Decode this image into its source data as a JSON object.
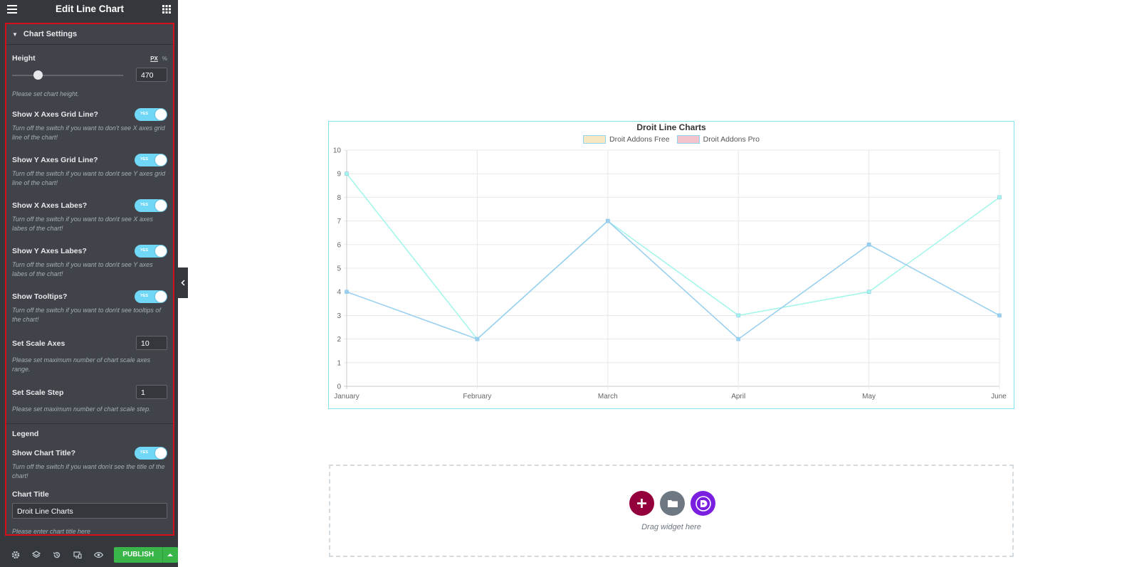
{
  "header": {
    "title": "Edit Line Chart",
    "menu_icon": "hamburger-icon",
    "grid_icon": "apps-grid-icon"
  },
  "section": {
    "title": "Chart Settings"
  },
  "controls": {
    "height": {
      "label": "Height",
      "unit_px": "PX",
      "unit_pct": "%",
      "value": "470",
      "slider_level": 0.23,
      "desc": "Please set chart height."
    },
    "x_grid": {
      "label": "Show X Axes Grid Line?",
      "toggle": "YES",
      "desc": "Turn off the switch if you want to don't see X axes grid line of the chart!"
    },
    "y_grid": {
      "label": "Show Y Axes Grid Line?",
      "toggle": "YES",
      "desc": "Turn off the switch if you want to don\\t see Y axes grid line of the chart!"
    },
    "x_labels": {
      "label": "Show X Axes Labes?",
      "toggle": "YES",
      "desc": "Turn off the switch if you want to don\\t see X axes labes of the chart!"
    },
    "y_labels": {
      "label": "Show Y Axes Labes?",
      "toggle": "YES",
      "desc": "Turn off the switch if you want to don\\t see Y axes labes of the chart!"
    },
    "tooltips": {
      "label": "Show Tooltips?",
      "toggle": "YES",
      "desc": "Turn off the switch if you want to don\\t see tooltips of the chart!"
    },
    "scale_axes": {
      "label": "Set Scale Axes",
      "value": "10",
      "desc": "Please set maximum number of chart scale axes range."
    },
    "scale_step": {
      "label": "Set Scale Step",
      "value": "1",
      "desc": "Please set maximum number of chart scale step."
    },
    "legend_heading": "Legend",
    "show_title": {
      "label": "Show Chart Title?",
      "toggle": "YES",
      "desc": "Turn off the switch if you want don\\t see the title of the chart!"
    },
    "chart_title": {
      "label": "Chart Title",
      "value": "Droit Line Charts",
      "desc": "Please enter chart title here"
    }
  },
  "footer": {
    "publish_label": "PUBLISH"
  },
  "dropzone": {
    "text": "Drag widget here",
    "add_icon": "plus-icon",
    "template_icon": "folder-icon",
    "droit_icon": "droit-logo-icon"
  },
  "colors": {
    "accent_toggle": "#71d7f7",
    "publish": "#39b54a",
    "highlight_border": "#d40f1a",
    "series_free": "#a5f6ea",
    "series_pro": "#9ad0ef"
  },
  "chart_data": {
    "type": "line",
    "title": "Droit Line Charts",
    "categories": [
      "January",
      "February",
      "March",
      "April",
      "May",
      "June"
    ],
    "series": [
      {
        "name": "Droit Addons Free",
        "values": [
          9,
          2,
          7,
          3,
          4,
          8
        ],
        "color": "#a5f6ea",
        "legend_fill": "#f7e8c4"
      },
      {
        "name": "Droit Addons Pro",
        "values": [
          4,
          2,
          7,
          2,
          6,
          3
        ],
        "color": "#9ad0ef",
        "legend_fill": "#f4c2cb"
      }
    ],
    "ylim": [
      0,
      10
    ],
    "yticks": [
      "0",
      "1",
      "2",
      "3",
      "4",
      "5",
      "6",
      "7",
      "8",
      "9",
      "10"
    ],
    "grid": true,
    "legend": "top-center"
  }
}
